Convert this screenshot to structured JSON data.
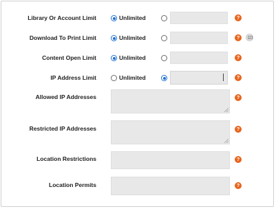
{
  "fields": {
    "library_limit": {
      "label": "Library Or Account Limit",
      "option_unlimited": "Unlimited",
      "selected": "unlimited",
      "value": ""
    },
    "download_limit": {
      "label": "Download To Print Limit",
      "option_unlimited": "Unlimited",
      "selected": "unlimited",
      "value": ""
    },
    "content_open_limit": {
      "label": "Content Open Limit",
      "option_unlimited": "Unlimited",
      "selected": "unlimited",
      "value": ""
    },
    "ip_address_limit": {
      "label": "IP Address Limit",
      "option_unlimited": "Unlimited",
      "selected": "custom",
      "value": ""
    },
    "allowed_ips": {
      "label": "Allowed IP Addresses",
      "value": ""
    },
    "restricted_ips": {
      "label": "Restricted IP Addresses",
      "value": ""
    },
    "location_restrictions": {
      "label": "Location Restrictions",
      "value": ""
    },
    "location_permits": {
      "label": "Location Permits",
      "value": ""
    }
  },
  "help_glyph": "?",
  "icons": {
    "help": "help-icon",
    "extra": "message-icon"
  },
  "colors": {
    "help": "#e8641c",
    "radio_checked": "#1f6fd1",
    "input_bg": "#e8e8e8"
  }
}
